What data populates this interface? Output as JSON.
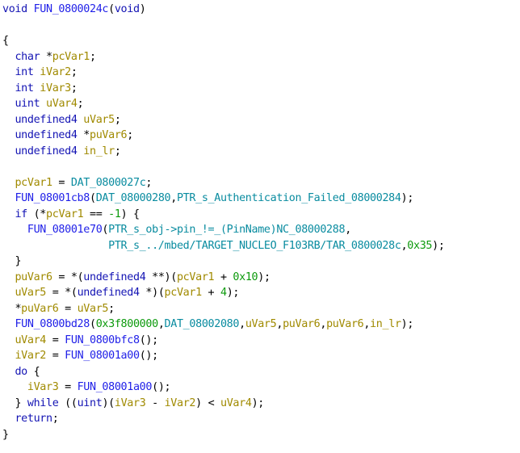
{
  "view": "decompiler-listing",
  "function_name": "FUN_0800024c",
  "lines": [
    [
      [
        "kw",
        "void"
      ],
      [
        "sp",
        " "
      ],
      [
        "fn",
        "FUN_0800024c"
      ],
      [
        "pun",
        "("
      ],
      [
        "kw",
        "void"
      ],
      [
        "pun",
        ")"
      ]
    ],
    [],
    [
      [
        "pun",
        "{"
      ]
    ],
    [
      [
        "sp",
        "  "
      ],
      [
        "kw",
        "char"
      ],
      [
        "sp",
        " "
      ],
      [
        "pun",
        "*"
      ],
      [
        "var",
        "pcVar1"
      ],
      [
        "pun",
        ";"
      ]
    ],
    [
      [
        "sp",
        "  "
      ],
      [
        "kw",
        "int"
      ],
      [
        "sp",
        " "
      ],
      [
        "var",
        "iVar2"
      ],
      [
        "pun",
        ";"
      ]
    ],
    [
      [
        "sp",
        "  "
      ],
      [
        "kw",
        "int"
      ],
      [
        "sp",
        " "
      ],
      [
        "var",
        "iVar3"
      ],
      [
        "pun",
        ";"
      ]
    ],
    [
      [
        "sp",
        "  "
      ],
      [
        "kw",
        "uint"
      ],
      [
        "sp",
        " "
      ],
      [
        "var",
        "uVar4"
      ],
      [
        "pun",
        ";"
      ]
    ],
    [
      [
        "sp",
        "  "
      ],
      [
        "kw",
        "undefined4"
      ],
      [
        "sp",
        " "
      ],
      [
        "var",
        "uVar5"
      ],
      [
        "pun",
        ";"
      ]
    ],
    [
      [
        "sp",
        "  "
      ],
      [
        "kw",
        "undefined4"
      ],
      [
        "sp",
        " "
      ],
      [
        "pun",
        "*"
      ],
      [
        "var",
        "puVar6"
      ],
      [
        "pun",
        ";"
      ]
    ],
    [
      [
        "sp",
        "  "
      ],
      [
        "kw",
        "undefined4"
      ],
      [
        "sp",
        " "
      ],
      [
        "var",
        "in_lr"
      ],
      [
        "pun",
        ";"
      ]
    ],
    [],
    [
      [
        "sp",
        "  "
      ],
      [
        "var",
        "pcVar1"
      ],
      [
        "pun",
        " = "
      ],
      [
        "glob",
        "DAT_0800027c"
      ],
      [
        "pun",
        ";"
      ]
    ],
    [
      [
        "sp",
        "  "
      ],
      [
        "fn",
        "FUN_08001cb8"
      ],
      [
        "pun",
        "("
      ],
      [
        "glob",
        "DAT_08000280"
      ],
      [
        "pun",
        ","
      ],
      [
        "glob",
        "PTR_s_Authentication_Failed_08000284"
      ],
      [
        "pun",
        ");"
      ]
    ],
    [
      [
        "sp",
        "  "
      ],
      [
        "kw",
        "if"
      ],
      [
        "pun",
        " (*"
      ],
      [
        "var",
        "pcVar1"
      ],
      [
        "pun",
        " == "
      ],
      [
        "num",
        "-1"
      ],
      [
        "pun",
        ") {"
      ]
    ],
    [
      [
        "sp",
        "    "
      ],
      [
        "fn",
        "FUN_08001e70"
      ],
      [
        "pun",
        "("
      ],
      [
        "glob",
        "PTR_s_obj->pin_!=_(PinName)NC_08000288"
      ],
      [
        "pun",
        ","
      ]
    ],
    [
      [
        "sp",
        "                 "
      ],
      [
        "glob",
        "PTR_s_../mbed/TARGET_NUCLEO_F103RB/TAR_0800028c"
      ],
      [
        "pun",
        ","
      ],
      [
        "num",
        "0x35"
      ],
      [
        "pun",
        ");"
      ]
    ],
    [
      [
        "sp",
        "  "
      ],
      [
        "pun",
        "}"
      ]
    ],
    [
      [
        "sp",
        "  "
      ],
      [
        "var",
        "puVar6"
      ],
      [
        "pun",
        " = *("
      ],
      [
        "kw",
        "undefined4"
      ],
      [
        "pun",
        " **)("
      ],
      [
        "var",
        "pcVar1"
      ],
      [
        "pun",
        " + "
      ],
      [
        "num",
        "0x10"
      ],
      [
        "pun",
        ");"
      ]
    ],
    [
      [
        "sp",
        "  "
      ],
      [
        "var",
        "uVar5"
      ],
      [
        "pun",
        " = *("
      ],
      [
        "kw",
        "undefined4"
      ],
      [
        "pun",
        " *)("
      ],
      [
        "var",
        "pcVar1"
      ],
      [
        "pun",
        " + "
      ],
      [
        "num",
        "4"
      ],
      [
        "pun",
        ");"
      ]
    ],
    [
      [
        "sp",
        "  "
      ],
      [
        "pun",
        "*"
      ],
      [
        "var",
        "puVar6"
      ],
      [
        "pun",
        " = "
      ],
      [
        "var",
        "uVar5"
      ],
      [
        "pun",
        ";"
      ]
    ],
    [
      [
        "sp",
        "  "
      ],
      [
        "fn",
        "FUN_0800bd28"
      ],
      [
        "pun",
        "("
      ],
      [
        "num",
        "0x3f800000"
      ],
      [
        "pun",
        ","
      ],
      [
        "glob",
        "DAT_08002080"
      ],
      [
        "pun",
        ","
      ],
      [
        "var",
        "uVar5"
      ],
      [
        "pun",
        ","
      ],
      [
        "var",
        "puVar6"
      ],
      [
        "pun",
        ","
      ],
      [
        "var",
        "puVar6"
      ],
      [
        "pun",
        ","
      ],
      [
        "var",
        "in_lr"
      ],
      [
        "pun",
        ");"
      ]
    ],
    [
      [
        "sp",
        "  "
      ],
      [
        "var",
        "uVar4"
      ],
      [
        "pun",
        " = "
      ],
      [
        "fn",
        "FUN_0800bfc8"
      ],
      [
        "pun",
        "();"
      ]
    ],
    [
      [
        "sp",
        "  "
      ],
      [
        "var",
        "iVar2"
      ],
      [
        "pun",
        " = "
      ],
      [
        "fn",
        "FUN_08001a00"
      ],
      [
        "pun",
        "();"
      ]
    ],
    [
      [
        "sp",
        "  "
      ],
      [
        "kw",
        "do"
      ],
      [
        "pun",
        " {"
      ]
    ],
    [
      [
        "sp",
        "    "
      ],
      [
        "var",
        "iVar3"
      ],
      [
        "pun",
        " = "
      ],
      [
        "fn",
        "FUN_08001a00"
      ],
      [
        "pun",
        "();"
      ]
    ],
    [
      [
        "sp",
        "  "
      ],
      [
        "pun",
        "} "
      ],
      [
        "kw",
        "while"
      ],
      [
        "pun",
        " (("
      ],
      [
        "kw",
        "uint"
      ],
      [
        "pun",
        ")("
      ],
      [
        "var",
        "iVar3"
      ],
      [
        "pun",
        " - "
      ],
      [
        "var",
        "iVar2"
      ],
      [
        "pun",
        ") < "
      ],
      [
        "var",
        "uVar4"
      ],
      [
        "pun",
        ");"
      ]
    ],
    [
      [
        "sp",
        "  "
      ],
      [
        "kw",
        "return"
      ],
      [
        "pun",
        ";"
      ]
    ],
    [
      [
        "pun",
        "}"
      ]
    ]
  ]
}
